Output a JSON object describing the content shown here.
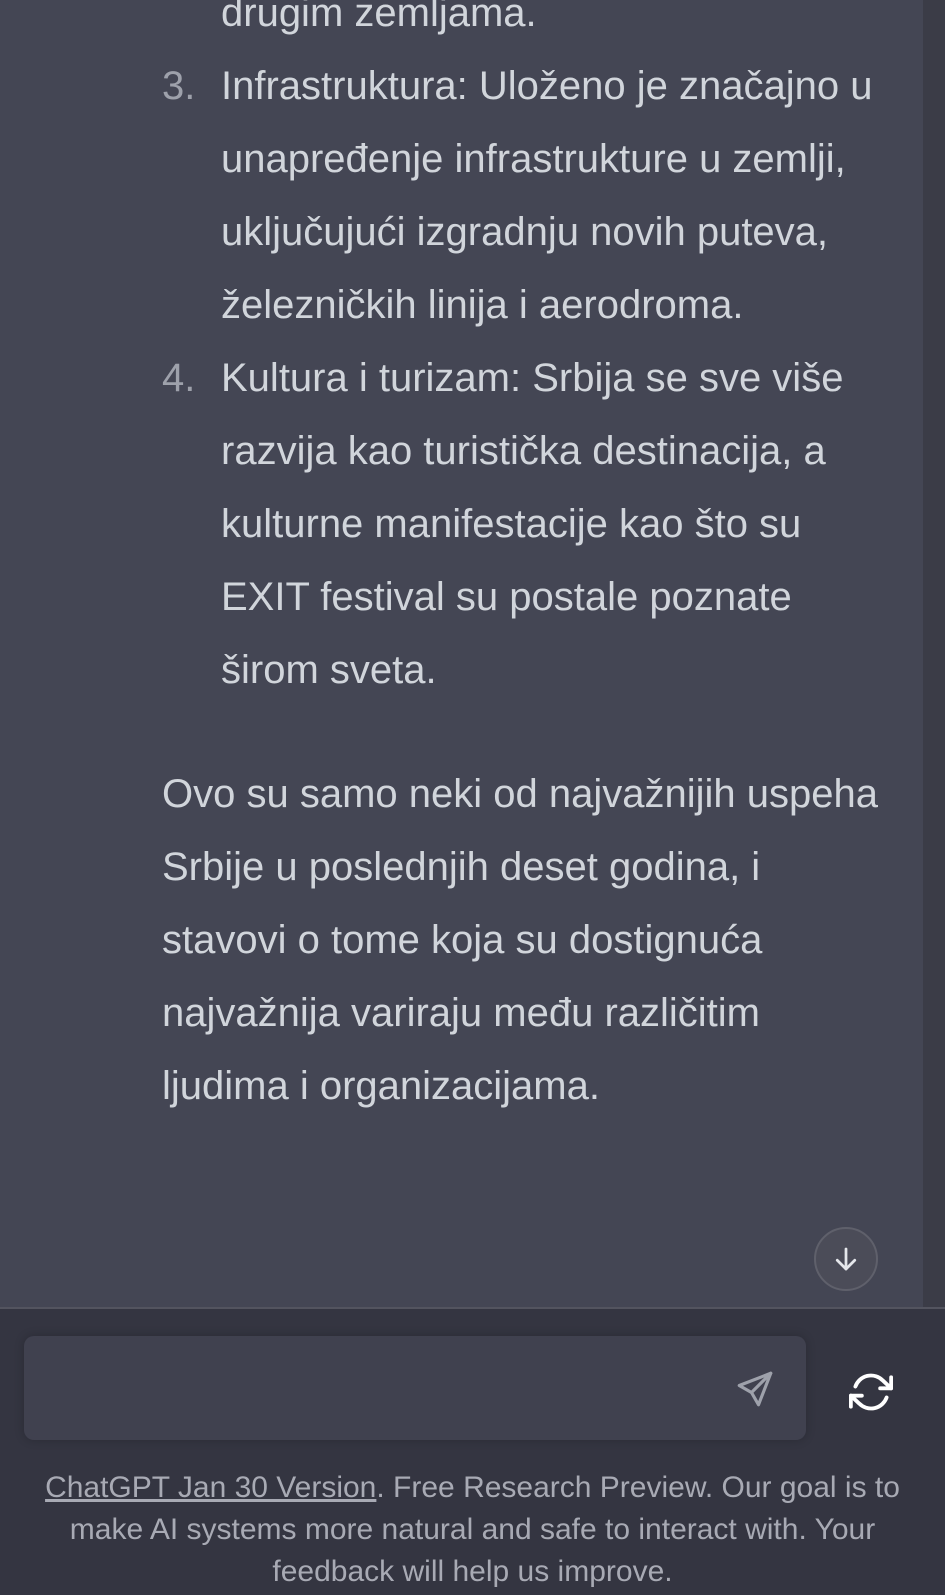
{
  "chat": {
    "continuation": "drugim zemljama.",
    "list": [
      {
        "number": "3.",
        "text": "Infrastruktura: Uloženo je značajno u unapređenje infrastrukture u zemlji, uključujući izgradnju novih puteva, železničkih linija i aerodroma."
      },
      {
        "number": "4.",
        "text": "Kultura i turizam: Srbija se sve više razvija kao turistička destinacija, a kulturne manifestacije kao što su EXIT festival su postale poznate širom sveta."
      }
    ],
    "summary": "Ovo su samo neki od najvažnijih uspeha Srbije u poslednjih deset godina, i stavovi o tome koja su dostignuća najvažnija variraju među različitim ljudima i organizacijama."
  },
  "controls": {
    "scroll_down_icon": "arrow-down-icon",
    "send_icon": "paper-plane-icon",
    "regenerate_icon": "refresh-icon"
  },
  "input": {
    "value": "",
    "placeholder": ""
  },
  "footer": {
    "link_text": "ChatGPT Jan 30 Version",
    "text": ". Free Research Preview. Our goal is to make AI systems more natural and safe to interact with. Your feedback will help us improve."
  },
  "colors": {
    "background": "#343541",
    "message_background": "#444654",
    "text": "#d1d5db",
    "input_background": "#40414f"
  }
}
